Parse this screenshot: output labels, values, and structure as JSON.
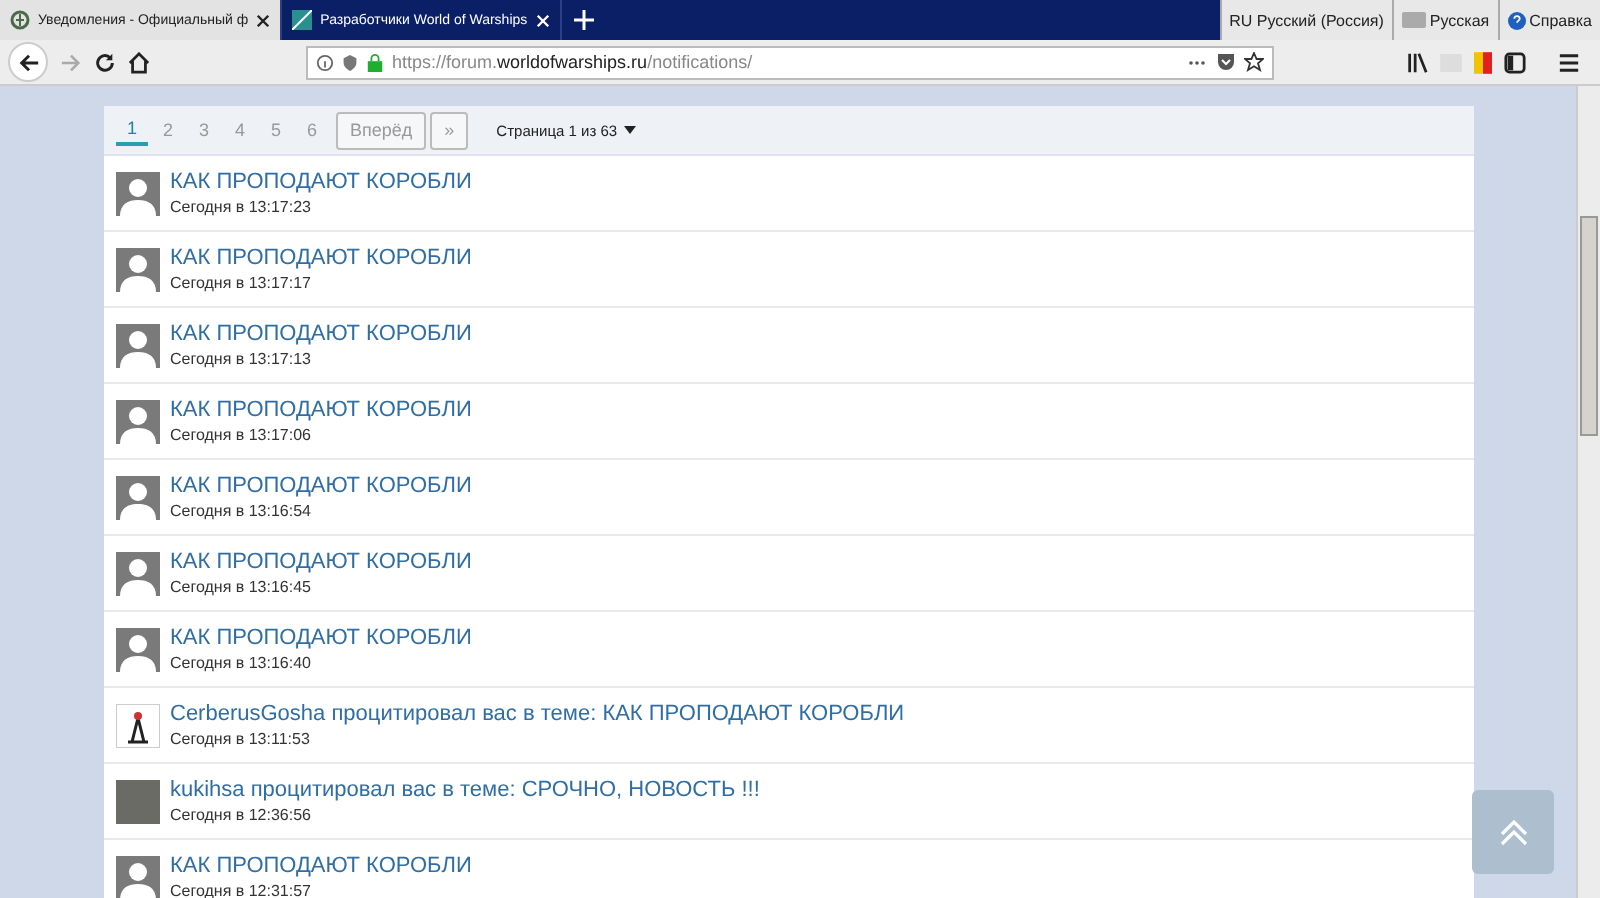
{
  "browser": {
    "tabs": [
      {
        "title": "Уведомления - Официальный ф",
        "selected": true
      },
      {
        "title": "Разработчики World of Warships",
        "selected": false
      }
    ],
    "language_bar": [
      "RU Русский (Россия)",
      "Русская",
      "Справка"
    ],
    "url": {
      "scheme": "https://forum.",
      "domain": "worldofwarships.ru",
      "path": "/notifications/"
    }
  },
  "pagination": {
    "pages": [
      {
        "label": "1",
        "selected": true
      },
      {
        "label": "2",
        "selected": false
      },
      {
        "label": "3",
        "selected": false
      },
      {
        "label": "4",
        "selected": false
      },
      {
        "label": "5",
        "selected": false
      },
      {
        "label": "6",
        "selected": false
      }
    ],
    "next": "Вперёд",
    "last": "»",
    "page_info": "Страница 1 из 63"
  },
  "notifications": [
    {
      "kind": "default",
      "title": "КАК ПРОПОДАЮТ КОРОБЛИ",
      "time": "Сегодня в 13:17:23"
    },
    {
      "kind": "default",
      "title": "КАК ПРОПОДАЮТ КОРОБЛИ",
      "time": "Сегодня в 13:17:17"
    },
    {
      "kind": "default",
      "title": "КАК ПРОПОДАЮТ КОРОБЛИ",
      "time": "Сегодня в 13:17:13"
    },
    {
      "kind": "default",
      "title": "КАК ПРОПОДАЮТ КОРОБЛИ",
      "time": "Сегодня в 13:17:06"
    },
    {
      "kind": "default",
      "title": "КАК ПРОПОДАЮТ КОРОБЛИ",
      "time": "Сегодня в 13:16:54"
    },
    {
      "kind": "default",
      "title": "КАК ПРОПОДАЮТ КОРОБЛИ",
      "time": "Сегодня в 13:16:45"
    },
    {
      "kind": "default",
      "title": "КАК ПРОПОДАЮТ КОРОБЛИ",
      "time": "Сегодня в 13:16:40"
    },
    {
      "kind": "drawing",
      "title": "CerberusGosha процитировал вас в теме: КАК ПРОПОДАЮТ КОРОБЛИ",
      "time": "Сегодня в 13:11:53"
    },
    {
      "kind": "photo",
      "title": "kukihsa процитировал вас в теме: СРОЧНО, НОВОСТЬ !!!",
      "time": "Сегодня в 12:36:56"
    },
    {
      "kind": "default",
      "title": "КАК ПРОПОДАЮТ КОРОБЛИ",
      "time": "Сегодня в 12:31:57"
    }
  ]
}
